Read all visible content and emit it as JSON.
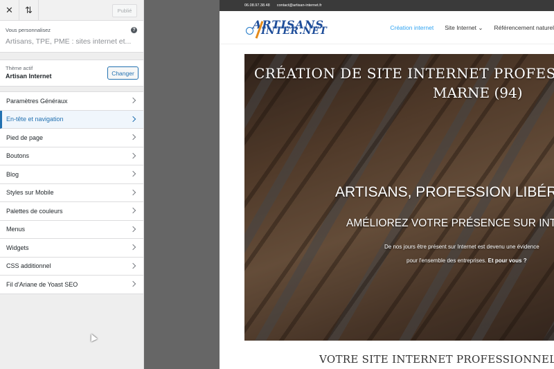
{
  "customizer": {
    "close_icon": "close-icon",
    "reorder_icon": "sort-arrows-icon",
    "publish_label": "Publié",
    "info_heading": "Vous personnalisez",
    "site_title": "Artisans, TPE, PME : sites internet et...",
    "help_icon": "?",
    "theme_label": "Thème actif",
    "theme_name": "Artisan Internet",
    "change_label": "Changer",
    "menu": [
      {
        "label": "Paramètres Généraux"
      },
      {
        "label": "En-tête et navigation"
      },
      {
        "label": "Pied de page"
      },
      {
        "label": "Boutons"
      },
      {
        "label": "Blog"
      },
      {
        "label": "Styles sur Mobile"
      },
      {
        "label": "Palettes de couleurs"
      },
      {
        "label": "Menus"
      },
      {
        "label": "Widgets"
      },
      {
        "label": "CSS additionnel"
      },
      {
        "label": "Fil d'Ariane de Yoast SEO"
      }
    ],
    "active_index": 1,
    "accent_color": "#2271b1"
  },
  "preview": {
    "phone": "06.08.97.38.48",
    "email": "contact@artisan-internet.fr",
    "logo_line1": "ARTISANS",
    "logo_line2": "INTER.NET",
    "nav": {
      "item1": "Création internet",
      "item2": "Site Internet",
      "item3": "Référencement naturel"
    },
    "hero": {
      "title_line1": "CRÉATION DE SITE INTERNET PROFESSIONNEL",
      "title_line2": "MARNE (94)",
      "h2": "ARTISANS, PROFESSION LIBÉRALE",
      "h3": "AMÉLIOREZ VOTRE PRÉSENCE SUR INTERNET",
      "p1": "De nos jours être présent sur Internet est devenu une évidence",
      "p2": "pour l'ensemble des entreprises.",
      "p2_bold": "Et pour vous ?"
    },
    "section_title": "VOTRE SITE INTERNET PROFESSIONNEL"
  }
}
